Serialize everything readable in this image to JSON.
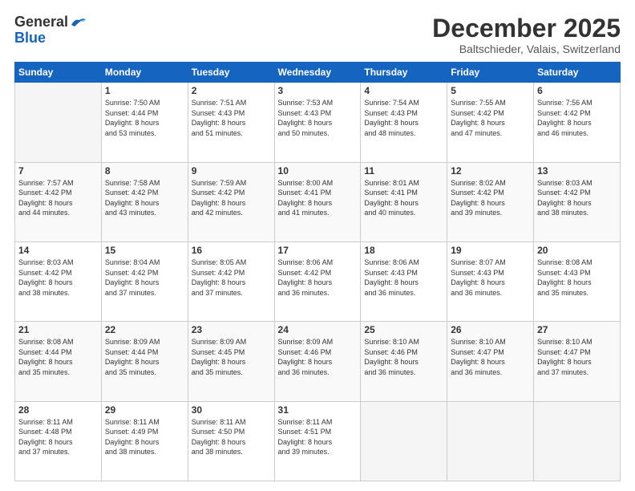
{
  "header": {
    "logo_general": "General",
    "logo_blue": "Blue",
    "month_title": "December 2025",
    "location": "Baltschieder, Valais, Switzerland"
  },
  "days_of_week": [
    "Sunday",
    "Monday",
    "Tuesday",
    "Wednesday",
    "Thursday",
    "Friday",
    "Saturday"
  ],
  "weeks": [
    [
      {
        "day": "",
        "info": ""
      },
      {
        "day": "1",
        "info": "Sunrise: 7:50 AM\nSunset: 4:44 PM\nDaylight: 8 hours\nand 53 minutes."
      },
      {
        "day": "2",
        "info": "Sunrise: 7:51 AM\nSunset: 4:43 PM\nDaylight: 8 hours\nand 51 minutes."
      },
      {
        "day": "3",
        "info": "Sunrise: 7:53 AM\nSunset: 4:43 PM\nDaylight: 8 hours\nand 50 minutes."
      },
      {
        "day": "4",
        "info": "Sunrise: 7:54 AM\nSunset: 4:43 PM\nDaylight: 8 hours\nand 48 minutes."
      },
      {
        "day": "5",
        "info": "Sunrise: 7:55 AM\nSunset: 4:42 PM\nDaylight: 8 hours\nand 47 minutes."
      },
      {
        "day": "6",
        "info": "Sunrise: 7:56 AM\nSunset: 4:42 PM\nDaylight: 8 hours\nand 46 minutes."
      }
    ],
    [
      {
        "day": "7",
        "info": "Sunrise: 7:57 AM\nSunset: 4:42 PM\nDaylight: 8 hours\nand 44 minutes."
      },
      {
        "day": "8",
        "info": "Sunrise: 7:58 AM\nSunset: 4:42 PM\nDaylight: 8 hours\nand 43 minutes."
      },
      {
        "day": "9",
        "info": "Sunrise: 7:59 AM\nSunset: 4:42 PM\nDaylight: 8 hours\nand 42 minutes."
      },
      {
        "day": "10",
        "info": "Sunrise: 8:00 AM\nSunset: 4:41 PM\nDaylight: 8 hours\nand 41 minutes."
      },
      {
        "day": "11",
        "info": "Sunrise: 8:01 AM\nSunset: 4:41 PM\nDaylight: 8 hours\nand 40 minutes."
      },
      {
        "day": "12",
        "info": "Sunrise: 8:02 AM\nSunset: 4:42 PM\nDaylight: 8 hours\nand 39 minutes."
      },
      {
        "day": "13",
        "info": "Sunrise: 8:03 AM\nSunset: 4:42 PM\nDaylight: 8 hours\nand 38 minutes."
      }
    ],
    [
      {
        "day": "14",
        "info": "Sunrise: 8:03 AM\nSunset: 4:42 PM\nDaylight: 8 hours\nand 38 minutes."
      },
      {
        "day": "15",
        "info": "Sunrise: 8:04 AM\nSunset: 4:42 PM\nDaylight: 8 hours\nand 37 minutes."
      },
      {
        "day": "16",
        "info": "Sunrise: 8:05 AM\nSunset: 4:42 PM\nDaylight: 8 hours\nand 37 minutes."
      },
      {
        "day": "17",
        "info": "Sunrise: 8:06 AM\nSunset: 4:42 PM\nDaylight: 8 hours\nand 36 minutes."
      },
      {
        "day": "18",
        "info": "Sunrise: 8:06 AM\nSunset: 4:43 PM\nDaylight: 8 hours\nand 36 minutes."
      },
      {
        "day": "19",
        "info": "Sunrise: 8:07 AM\nSunset: 4:43 PM\nDaylight: 8 hours\nand 36 minutes."
      },
      {
        "day": "20",
        "info": "Sunrise: 8:08 AM\nSunset: 4:43 PM\nDaylight: 8 hours\nand 35 minutes."
      }
    ],
    [
      {
        "day": "21",
        "info": "Sunrise: 8:08 AM\nSunset: 4:44 PM\nDaylight: 8 hours\nand 35 minutes."
      },
      {
        "day": "22",
        "info": "Sunrise: 8:09 AM\nSunset: 4:44 PM\nDaylight: 8 hours\nand 35 minutes."
      },
      {
        "day": "23",
        "info": "Sunrise: 8:09 AM\nSunset: 4:45 PM\nDaylight: 8 hours\nand 35 minutes."
      },
      {
        "day": "24",
        "info": "Sunrise: 8:09 AM\nSunset: 4:46 PM\nDaylight: 8 hours\nand 36 minutes."
      },
      {
        "day": "25",
        "info": "Sunrise: 8:10 AM\nSunset: 4:46 PM\nDaylight: 8 hours\nand 36 minutes."
      },
      {
        "day": "26",
        "info": "Sunrise: 8:10 AM\nSunset: 4:47 PM\nDaylight: 8 hours\nand 36 minutes."
      },
      {
        "day": "27",
        "info": "Sunrise: 8:10 AM\nSunset: 4:47 PM\nDaylight: 8 hours\nand 37 minutes."
      }
    ],
    [
      {
        "day": "28",
        "info": "Sunrise: 8:11 AM\nSunset: 4:48 PM\nDaylight: 8 hours\nand 37 minutes."
      },
      {
        "day": "29",
        "info": "Sunrise: 8:11 AM\nSunset: 4:49 PM\nDaylight: 8 hours\nand 38 minutes."
      },
      {
        "day": "30",
        "info": "Sunrise: 8:11 AM\nSunset: 4:50 PM\nDaylight: 8 hours\nand 38 minutes."
      },
      {
        "day": "31",
        "info": "Sunrise: 8:11 AM\nSunset: 4:51 PM\nDaylight: 8 hours\nand 39 minutes."
      },
      {
        "day": "",
        "info": ""
      },
      {
        "day": "",
        "info": ""
      },
      {
        "day": "",
        "info": ""
      }
    ]
  ]
}
